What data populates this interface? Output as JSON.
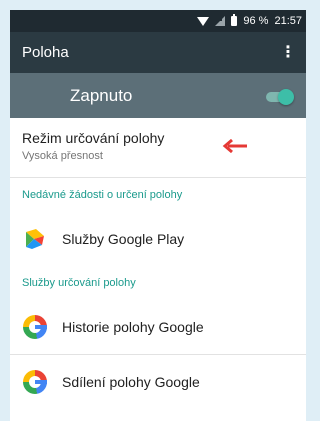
{
  "status_bar": {
    "battery": "96 %",
    "time": "21:57"
  },
  "app_bar": {
    "title": "Poloha",
    "menu_icon": "⋮"
  },
  "master_switch": {
    "label": "Zapnuto",
    "state": "on"
  },
  "mode": {
    "title": "Režim určování polohy",
    "value": "Vysoká přesnost"
  },
  "recent_requests": {
    "header": "Nedávné žádosti o určení polohy",
    "items": [
      {
        "icon": "google-play-services-icon",
        "label": "Služby Google Play"
      }
    ]
  },
  "location_services": {
    "header": "Služby určování polohy",
    "items": [
      {
        "icon": "google-g-icon",
        "label": "Historie polohy Google"
      },
      {
        "icon": "google-g-icon",
        "label": "Sdílení polohy Google"
      }
    ]
  },
  "colors": {
    "status_bar": "#1f2a31",
    "app_bar": "#2b3a42",
    "master_bar": "#5c6f78",
    "accent": "#1a9a8c",
    "annotation_arrow": "#e53935"
  }
}
